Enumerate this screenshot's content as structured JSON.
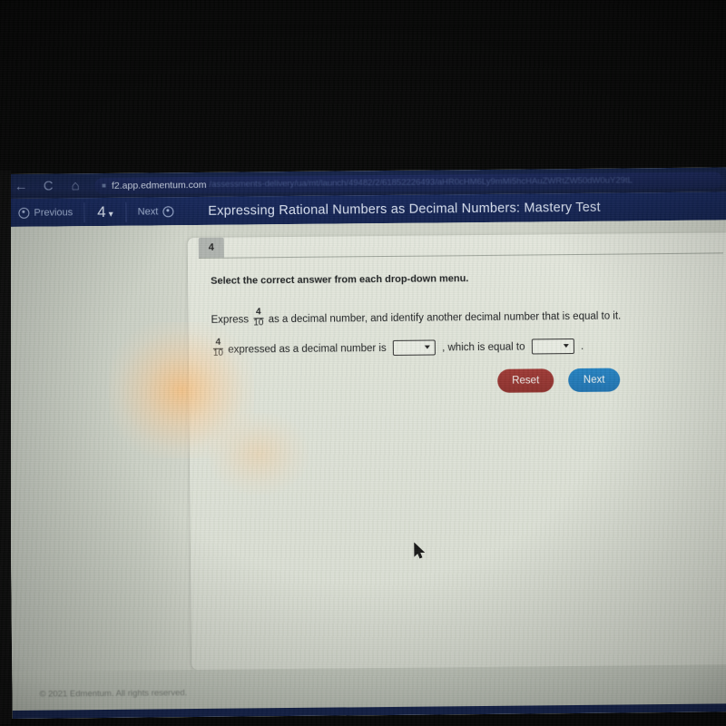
{
  "browser": {
    "back_icon": "back-arrow-icon",
    "reload_icon": "reload-icon",
    "home_icon": "home-icon",
    "lock_icon": "lock-icon",
    "url_host": "f2.app.edmentum.com",
    "url_path": "/assessments-delivery/ua/mt/launch/49482/2/61852226493/aHR0cHM6Ly9mMi5hcHAuZWRtZW50dW0uY29tL"
  },
  "nav": {
    "previous_label": "Previous",
    "previous_icon": "circle-left-icon",
    "question_number": "4",
    "chevron_icon": "chevron-down-icon",
    "next_label": "Next",
    "next_icon": "circle-right-icon",
    "test_title": "Expressing Rational Numbers as Decimal Numbers: Mastery Test"
  },
  "question": {
    "badge_number": "4",
    "instruction": "Select the correct answer from each drop-down menu.",
    "express_prefix": "Express",
    "fraction_numerator": "4",
    "fraction_denominator": "10",
    "express_suffix": "as a decimal number, and identify another decimal number that is equal to it.",
    "answer_mid": "expressed as a decimal number is",
    "answer_join": ", which is equal to",
    "answer_end": ".",
    "dropdown1_value": "",
    "dropdown2_value": "",
    "dropdown_placeholder": ""
  },
  "buttons": {
    "reset_label": "Reset",
    "reset_color": "#8f2f2b",
    "next_label": "Next",
    "next_color": "#1d77b8"
  },
  "footer": {
    "copyright": "© 2021 Edmentum. All rights reserved."
  },
  "cursor": {
    "icon": "mouse-pointer-icon"
  }
}
